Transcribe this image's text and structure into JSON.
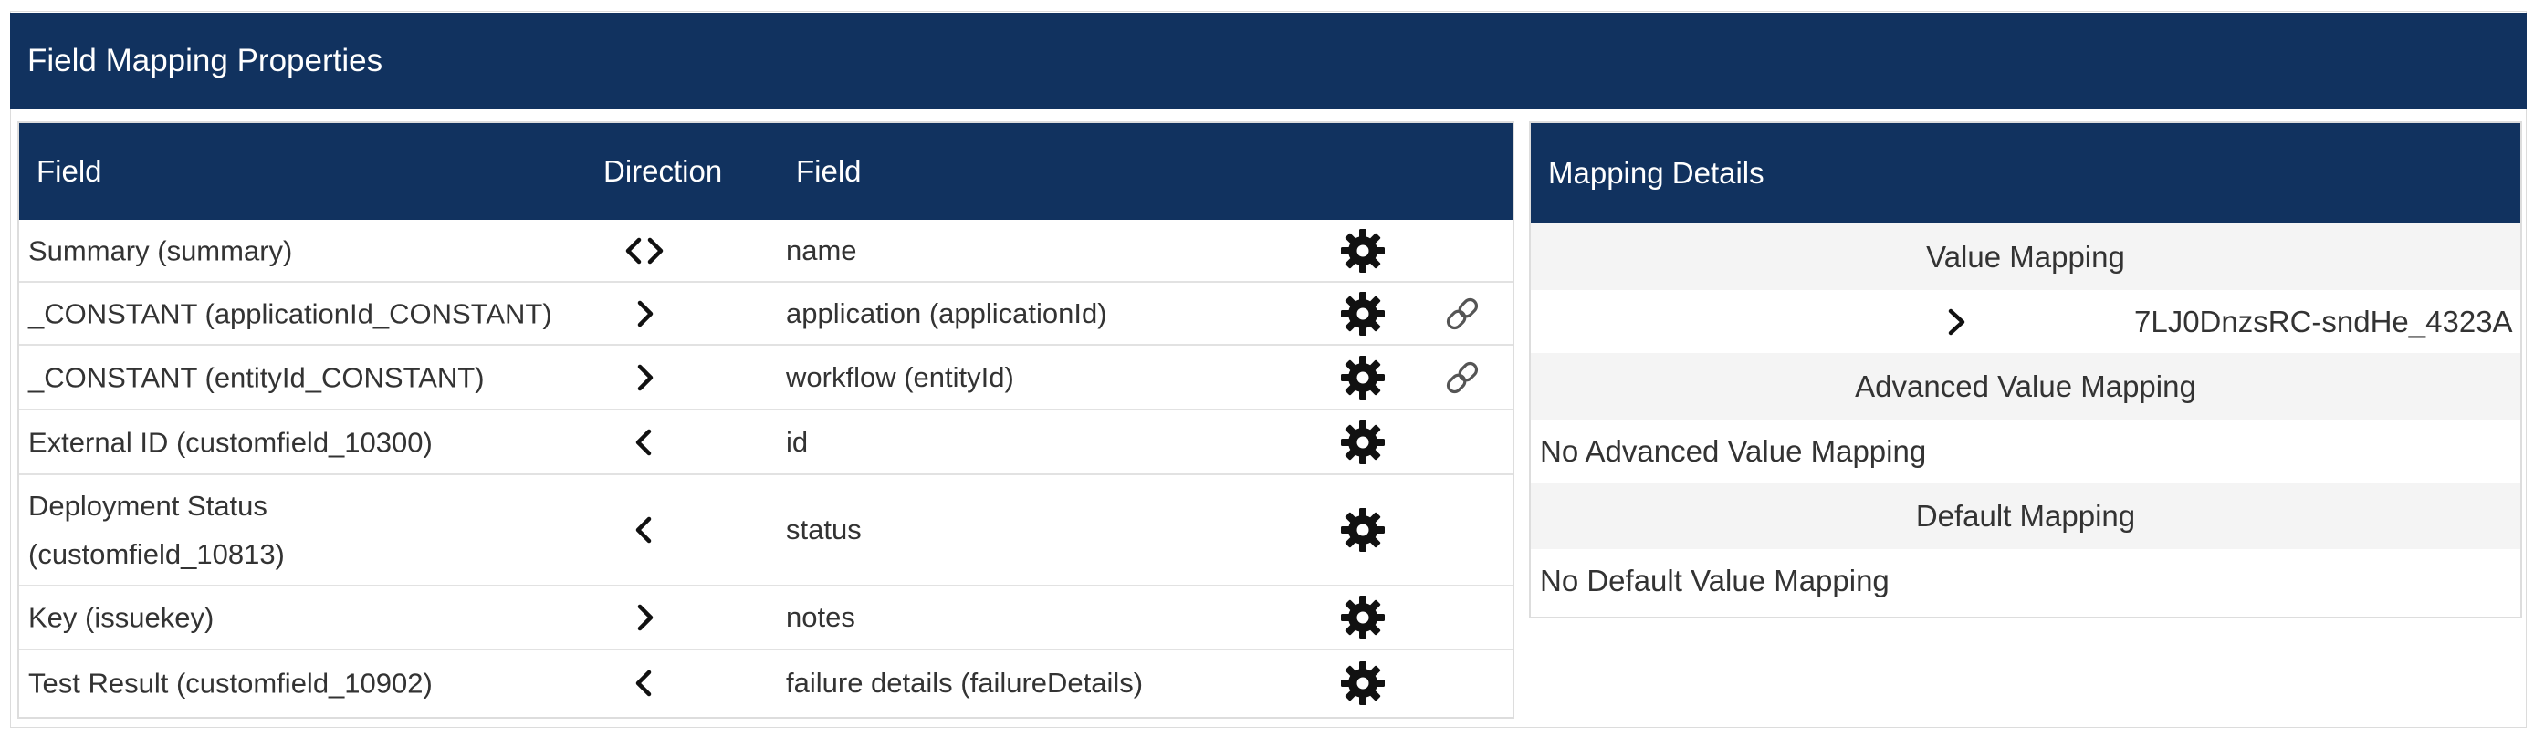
{
  "page_title": "Field Mapping Properties",
  "mapping_table": {
    "headers": {
      "source_field": "Field",
      "direction": "Direction",
      "target_field": "Field"
    },
    "rows": [
      {
        "source": "Summary (summary)",
        "direction": "bidirectional",
        "target": "name",
        "has_link": false
      },
      {
        "source": "_CONSTANT (applicationId_CONSTANT)",
        "direction": "right",
        "target": "application (applicationId)",
        "has_link": true
      },
      {
        "source": "_CONSTANT (entityId_CONSTANT)",
        "direction": "right",
        "target": "workflow (entityId)",
        "has_link": true
      },
      {
        "source": "External ID (customfield_10300)",
        "direction": "left",
        "target": "id",
        "has_link": false
      },
      {
        "source": "Deployment Status (customfield_10813)",
        "direction": "left",
        "target": "status",
        "has_link": false
      },
      {
        "source": "Key (issuekey)",
        "direction": "right",
        "target": "notes",
        "has_link": false
      },
      {
        "source": "Test Result (customfield_10902)",
        "direction": "left",
        "target": "failure details (failureDetails)",
        "has_link": false
      }
    ],
    "settings_icon": "gear-icon",
    "link_icon": "link-icon"
  },
  "mapping_details": {
    "title": "Mapping Details",
    "value_mapping": {
      "title": "Value Mapping",
      "direction": "right",
      "value": "7LJ0DnzsRC-sndHe_4323A"
    },
    "advanced_value_mapping": {
      "title": "Advanced Value Mapping",
      "text": "No Advanced Value Mapping"
    },
    "default_mapping": {
      "title": "Default Mapping",
      "text": "No Default Value Mapping"
    }
  },
  "colors": {
    "header_bg": "#11325f",
    "header_text": "#ffffff",
    "section_bg": "#f4f4f4",
    "body_text": "#333333"
  }
}
